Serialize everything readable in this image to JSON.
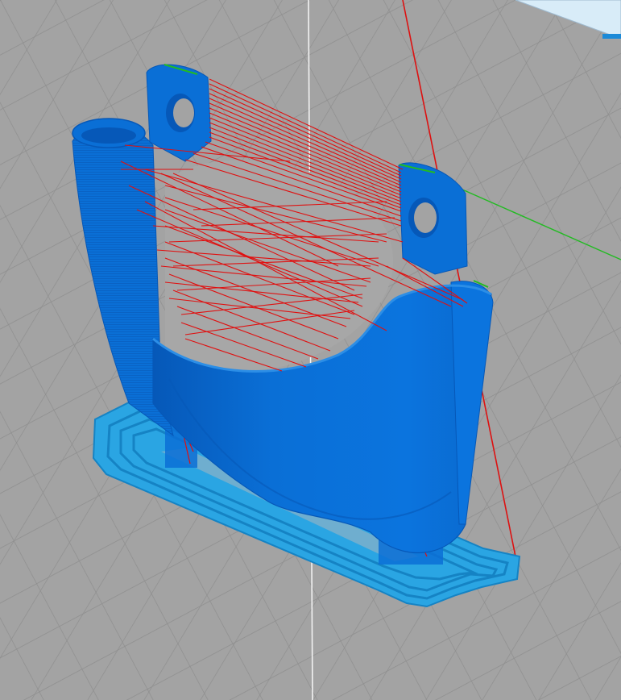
{
  "viewport": {
    "mode": "layer-preview",
    "colors": {
      "build_plate": "#a3a3a3",
      "grid_line": "#8e8e8e",
      "wall": "#0a6fd6",
      "wall_dark": "#0658b8",
      "wall_light": "#2c8ee6",
      "support_raft": "#2aa5e3",
      "travel_moves": "#e01010",
      "axis_x": "#dd1111",
      "axis_y": "#22bb22",
      "axis_z": "#f2f2f2",
      "background_sky": "#d8ecf8"
    },
    "icons": {
      "axis_gizmo": "axis-lines",
      "model": "printed-part-preview"
    }
  }
}
